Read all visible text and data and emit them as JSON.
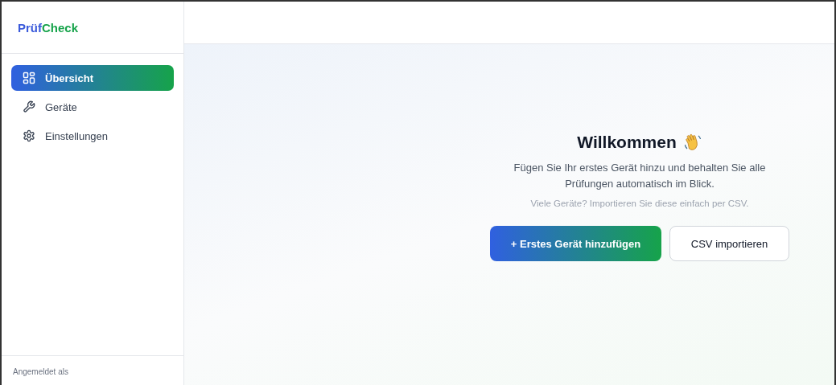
{
  "logo": {
    "part_1": "Prüf",
    "part_2": "Check"
  },
  "sidebar": {
    "items": [
      {
        "label": "Übersicht",
        "selected": true
      },
      {
        "label": "Geräte",
        "selected": false
      },
      {
        "label": "Einstellungen",
        "selected": false
      }
    ],
    "footer": "Angemeldet als"
  },
  "welcome": {
    "title": "Willkommen",
    "text": "Fügen Sie Ihr erstes Gerät hinzu und behalten Sie alle Prüfungen automatisch im Blick.",
    "hint": "Viele Geräte? Importieren Sie diese einfach per CSV.",
    "buttons": [
      {
        "label": "+ Erstes Gerät hinzufügen",
        "kind": "primary"
      },
      {
        "label": "CSV importieren",
        "kind": "secondary"
      }
    ]
  }
}
